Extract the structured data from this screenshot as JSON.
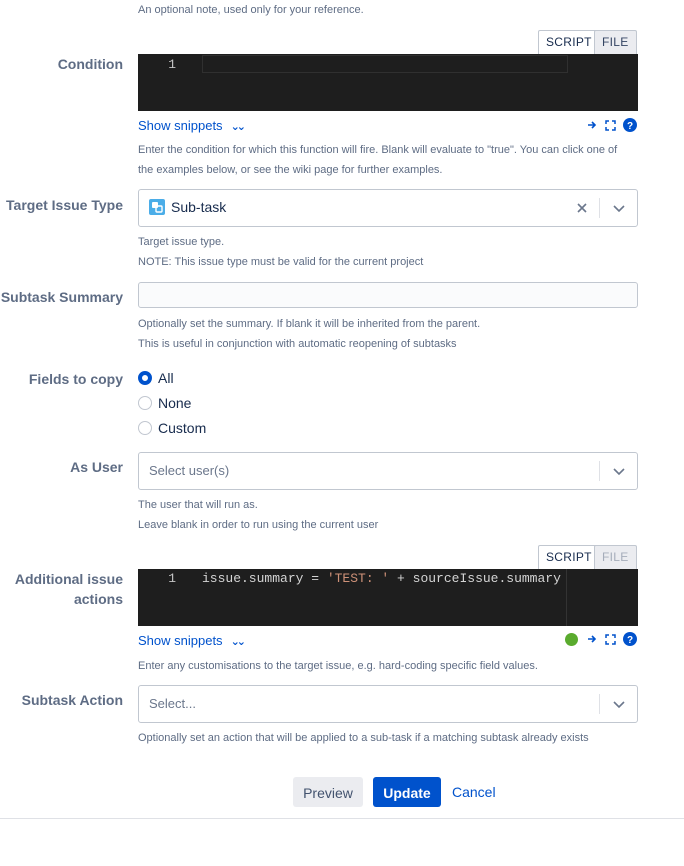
{
  "top_note": "An optional note, used only for your reference.",
  "condition": {
    "label": "Condition",
    "tabs": [
      "SCRIPT",
      "FILE"
    ],
    "line_numbers": [
      "1"
    ],
    "snippets_label": "Show snippets",
    "help_line1": "Enter the condition for which this function will fire. Blank will evaluate to \"true\". You can click one of",
    "help_line2": "the examples below, or see the wiki page for further examples."
  },
  "target_issue_type": {
    "label": "Target Issue Type",
    "value": "Sub-task",
    "help_line1": "Target issue type.",
    "help_line2": "NOTE: This issue type must be valid for the current project"
  },
  "subtask_summary": {
    "label": "Subtask Summary",
    "value": "",
    "help_line1": "Optionally set the summary. If blank it will be inherited from the parent.",
    "help_line2": "This is useful in conjunction with automatic reopening of subtasks"
  },
  "fields_to_copy": {
    "label": "Fields to copy",
    "options": [
      "All",
      "None",
      "Custom"
    ],
    "selected": "All"
  },
  "as_user": {
    "label": "As User",
    "placeholder": "Select user(s)",
    "help_line1": "The user that will run as.",
    "help_line2": "Leave blank in order to run using the current user"
  },
  "additional_actions": {
    "label_line1": "Additional issue",
    "label_line2": "actions",
    "tabs": [
      "SCRIPT",
      "FILE"
    ],
    "line_numbers": [
      "1"
    ],
    "code_part1": "issue.summary = ",
    "code_string": "'TEST: '",
    "code_part2": " + sourceIssue.summary",
    "snippets_label": "Show snippets",
    "help_line1": "Enter any customisations to the target issue, e.g. hard-coding specific field values."
  },
  "subtask_action": {
    "label": "Subtask Action",
    "placeholder": "Select...",
    "help_line1": "Optionally set an action that will be applied to a sub-task if a matching subtask already exists"
  },
  "buttons": {
    "preview": "Preview",
    "update": "Update",
    "cancel": "Cancel"
  },
  "colors": {
    "primary": "#0052cc",
    "editor_bg": "#1e1e1e",
    "status_ok": "#5aab2e",
    "label_text": "#5e6c84"
  },
  "icons": {
    "subtask": "subtask-icon",
    "clear": "close-icon",
    "dropdown": "chevron-down-icon",
    "run": "arrow-right-icon",
    "fullscreen": "fullscreen-icon",
    "help": "help-icon",
    "status": "status-dot-icon"
  }
}
